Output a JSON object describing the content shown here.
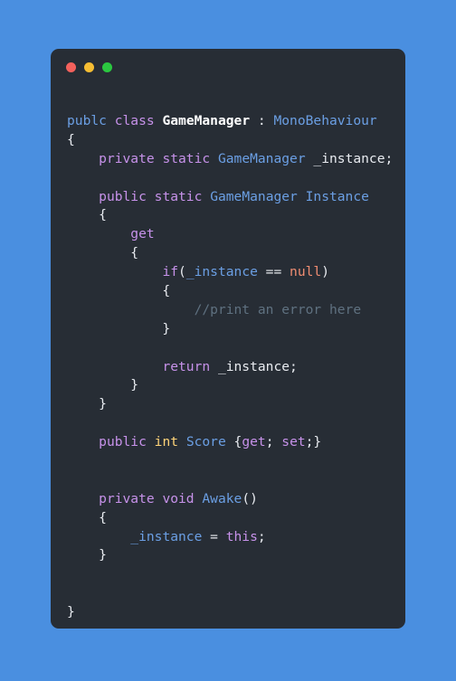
{
  "window": {
    "background_color": "#4a8fe0",
    "card_color": "#272d35",
    "traffic_lights": [
      {
        "name": "close",
        "color": "#f4615c"
      },
      {
        "name": "minimize",
        "color": "#f6bd33"
      },
      {
        "name": "zoom",
        "color": "#2bc840"
      }
    ]
  },
  "palette": {
    "keyword": "#c792ea",
    "identifier_blue": "#6b9fe4",
    "plain": "#e8ebf0",
    "class_name": "#ffffff",
    "value_type": "#ffd479",
    "constant": "#f08d72",
    "comment": "#5f7180"
  },
  "code": {
    "language": "csharp",
    "lines": [
      {
        "n": 1,
        "tokens": [
          {
            "t": "publc",
            "c": "blue"
          },
          {
            "t": " ",
            "c": "plain"
          },
          {
            "t": "class",
            "c": "kw"
          },
          {
            "t": " ",
            "c": "plain"
          },
          {
            "t": "GameManager",
            "c": "bold"
          },
          {
            "t": " : ",
            "c": "plain"
          },
          {
            "t": "MonoBehaviour",
            "c": "blue"
          }
        ]
      },
      {
        "n": 2,
        "tokens": [
          {
            "t": "{",
            "c": "plain"
          }
        ]
      },
      {
        "n": 3,
        "tokens": [
          {
            "t": "    ",
            "c": "plain"
          },
          {
            "t": "private static",
            "c": "kw"
          },
          {
            "t": " ",
            "c": "plain"
          },
          {
            "t": "GameManager",
            "c": "blue"
          },
          {
            "t": " ",
            "c": "plain"
          },
          {
            "t": "_instance",
            "c": "plain"
          },
          {
            "t": ";",
            "c": "plain"
          }
        ]
      },
      {
        "n": 4,
        "tokens": []
      },
      {
        "n": 5,
        "tokens": [
          {
            "t": "    ",
            "c": "plain"
          },
          {
            "t": "public static",
            "c": "kw"
          },
          {
            "t": " ",
            "c": "plain"
          },
          {
            "t": "GameManager Instance",
            "c": "blue"
          }
        ]
      },
      {
        "n": 6,
        "tokens": [
          {
            "t": "    {",
            "c": "plain"
          }
        ]
      },
      {
        "n": 7,
        "tokens": [
          {
            "t": "        ",
            "c": "plain"
          },
          {
            "t": "get",
            "c": "kw"
          }
        ]
      },
      {
        "n": 8,
        "tokens": [
          {
            "t": "        {",
            "c": "plain"
          }
        ]
      },
      {
        "n": 9,
        "tokens": [
          {
            "t": "            ",
            "c": "plain"
          },
          {
            "t": "if",
            "c": "kw"
          },
          {
            "t": "(",
            "c": "plain"
          },
          {
            "t": "_instance",
            "c": "blue"
          },
          {
            "t": " == ",
            "c": "plain"
          },
          {
            "t": "null",
            "c": "const"
          },
          {
            "t": ")",
            "c": "plain"
          }
        ]
      },
      {
        "n": 10,
        "tokens": [
          {
            "t": "            {",
            "c": "plain"
          }
        ]
      },
      {
        "n": 11,
        "tokens": [
          {
            "t": "                ",
            "c": "plain"
          },
          {
            "t": "//print an error here",
            "c": "comment"
          }
        ]
      },
      {
        "n": 12,
        "tokens": [
          {
            "t": "            }",
            "c": "plain"
          }
        ]
      },
      {
        "n": 13,
        "tokens": []
      },
      {
        "n": 14,
        "tokens": [
          {
            "t": "            ",
            "c": "plain"
          },
          {
            "t": "return",
            "c": "kw"
          },
          {
            "t": " ",
            "c": "plain"
          },
          {
            "t": "_instance",
            "c": "plain"
          },
          {
            "t": ";",
            "c": "plain"
          }
        ]
      },
      {
        "n": 15,
        "tokens": [
          {
            "t": "        }",
            "c": "plain"
          }
        ]
      },
      {
        "n": 16,
        "tokens": [
          {
            "t": "    }",
            "c": "plain"
          }
        ]
      },
      {
        "n": 17,
        "tokens": []
      },
      {
        "n": 18,
        "tokens": [
          {
            "t": "    ",
            "c": "plain"
          },
          {
            "t": "public",
            "c": "kw"
          },
          {
            "t": " ",
            "c": "plain"
          },
          {
            "t": "int",
            "c": "type"
          },
          {
            "t": " ",
            "c": "plain"
          },
          {
            "t": "Score",
            "c": "blue"
          },
          {
            "t": " {",
            "c": "plain"
          },
          {
            "t": "get",
            "c": "kw"
          },
          {
            "t": "; ",
            "c": "plain"
          },
          {
            "t": "set",
            "c": "kw"
          },
          {
            "t": ";}",
            "c": "plain"
          }
        ]
      },
      {
        "n": 19,
        "tokens": []
      },
      {
        "n": 20,
        "tokens": []
      },
      {
        "n": 21,
        "tokens": [
          {
            "t": "    ",
            "c": "plain"
          },
          {
            "t": "private void",
            "c": "kw"
          },
          {
            "t": " ",
            "c": "plain"
          },
          {
            "t": "Awake",
            "c": "blue"
          },
          {
            "t": "()",
            "c": "plain"
          }
        ]
      },
      {
        "n": 22,
        "tokens": [
          {
            "t": "    {",
            "c": "plain"
          }
        ]
      },
      {
        "n": 23,
        "tokens": [
          {
            "t": "        ",
            "c": "plain"
          },
          {
            "t": "_instance",
            "c": "blue"
          },
          {
            "t": " = ",
            "c": "plain"
          },
          {
            "t": "this",
            "c": "kw"
          },
          {
            "t": ";",
            "c": "plain"
          }
        ]
      },
      {
        "n": 24,
        "tokens": [
          {
            "t": "    }",
            "c": "plain"
          }
        ]
      },
      {
        "n": 25,
        "tokens": []
      },
      {
        "n": 26,
        "tokens": []
      },
      {
        "n": 27,
        "tokens": [
          {
            "t": "}",
            "c": "plain"
          }
        ]
      }
    ]
  }
}
